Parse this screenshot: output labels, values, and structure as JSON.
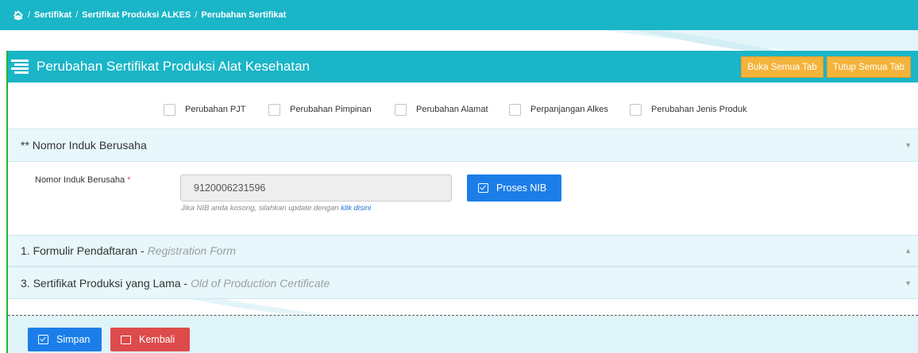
{
  "breadcrumb": {
    "home_icon": "home-icon",
    "items": [
      "Sertifikat",
      "Sertifikat Produksi ALKES",
      "Perubahan Sertifikat"
    ],
    "separator": "/"
  },
  "panel": {
    "title": "Perubahan Sertifikat Produksi Alat Kesehatan",
    "title_icon": "list-icon",
    "open_all_label": "Buka Semua Tab",
    "close_all_label": "Tutup Semua Tab"
  },
  "change_options": [
    {
      "label": "Perubahan PJT",
      "checked": false
    },
    {
      "label": "Perubahan Pimpinan",
      "checked": false
    },
    {
      "label": "Perubahan Alamat",
      "checked": false
    },
    {
      "label": "Perpanjangan Alkes",
      "checked": false
    },
    {
      "label": "Perubahan Jenis Produk",
      "checked": false
    }
  ],
  "sections": {
    "nib": {
      "title": "** Nomor Induk Berusaha",
      "expanded": true
    },
    "registration": {
      "title": "1. Formulir Pendaftaran -",
      "subtitle": "Registration Form",
      "expanded": false
    },
    "old_certificate": {
      "title": "3. Sertifikat Produksi yang Lama -",
      "subtitle": "Old of Production Certificate",
      "expanded": true
    }
  },
  "nib_form": {
    "label": "Nomor Induk Berusaha",
    "required_mark": "*",
    "value": "9120006231596",
    "help_text": "Jika NIB anda kosong, silahkan update dengan",
    "help_link": "klik disini",
    "process_button": "Proses NIB"
  },
  "footer": {
    "save_label": "Simpan",
    "back_label": "Kembali"
  },
  "colors": {
    "header_teal": "#1ab5c7",
    "accent_orange": "#f4b33a",
    "primary_blue": "#1b7ee8",
    "danger_red": "#dd4b4b",
    "section_bg": "#e7f7fb"
  }
}
